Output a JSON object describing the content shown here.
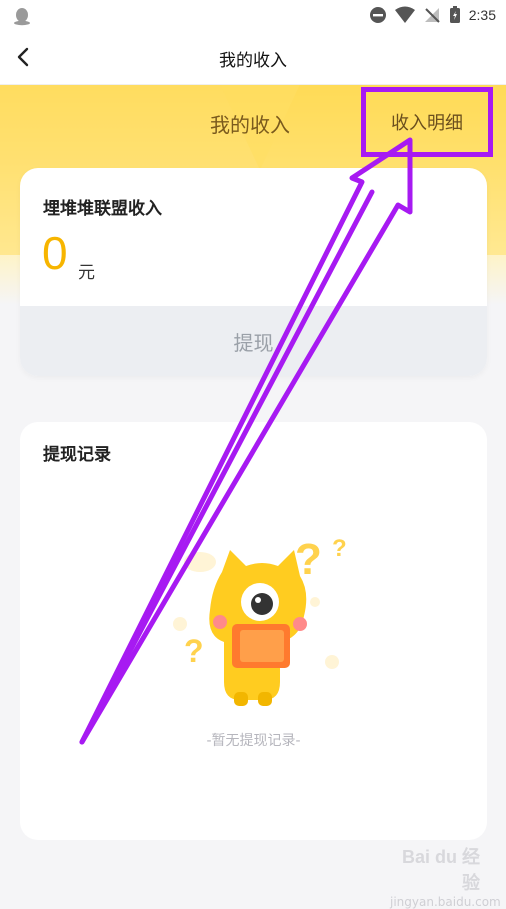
{
  "statusbar": {
    "time": "2:35"
  },
  "navbar": {
    "title": "我的收入"
  },
  "hero": {
    "title": "我的收入",
    "detail_label": "收入明细"
  },
  "income_card": {
    "title": "埋堆堆联盟收入",
    "amount": "0",
    "unit": "元",
    "withdraw_label": "提现"
  },
  "record_card": {
    "title": "提现记录",
    "empty_text": "-暂无提现记录-"
  },
  "watermark": {
    "logo": "Bai du 经验",
    "url": "jingyan.baidu.com"
  },
  "colors": {
    "accent_yellow": "#ffd84f",
    "amount": "#f7b500",
    "annotation_purple": "#a71af2"
  }
}
